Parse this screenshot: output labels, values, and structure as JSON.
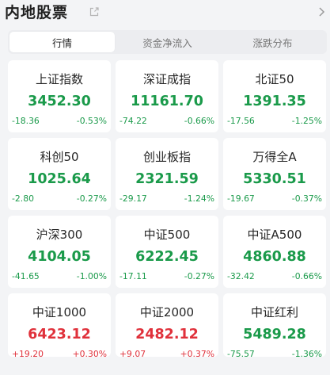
{
  "header": {
    "title": "内地股票",
    "share_icon": "share-external-icon",
    "more_icon": "chevron-right-icon"
  },
  "tabs": [
    {
      "label": "行情",
      "active": true
    },
    {
      "label": "资金净流入",
      "active": false
    },
    {
      "label": "涨跌分布",
      "active": false
    }
  ],
  "colors": {
    "down": "#1a9a4a",
    "up": "#e0313b"
  },
  "indices": [
    {
      "name": "上证指数",
      "value": "3452.30",
      "change": "-18.36",
      "percent": "-0.53%",
      "trend": "down"
    },
    {
      "name": "深证成指",
      "value": "11161.70",
      "change": "-74.22",
      "percent": "-0.66%",
      "trend": "down"
    },
    {
      "name": "北证50",
      "value": "1391.35",
      "change": "-17.56",
      "percent": "-1.25%",
      "trend": "down"
    },
    {
      "name": "科创50",
      "value": "1025.64",
      "change": "-2.80",
      "percent": "-0.27%",
      "trend": "down"
    },
    {
      "name": "创业板指",
      "value": "2321.59",
      "change": "-29.17",
      "percent": "-1.24%",
      "trend": "down"
    },
    {
      "name": "万得全A",
      "value": "5330.51",
      "change": "-19.67",
      "percent": "-0.37%",
      "trend": "down"
    },
    {
      "name": "沪深300",
      "value": "4104.05",
      "change": "-41.65",
      "percent": "-1.00%",
      "trend": "down"
    },
    {
      "name": "中证500",
      "value": "6222.45",
      "change": "-17.11",
      "percent": "-0.27%",
      "trend": "down"
    },
    {
      "name": "中证A500",
      "value": "4860.88",
      "change": "-32.42",
      "percent": "-0.66%",
      "trend": "down"
    },
    {
      "name": "中证1000",
      "value": "6423.12",
      "change": "+19.20",
      "percent": "+0.30%",
      "trend": "up"
    },
    {
      "name": "中证2000",
      "value": "2482.12",
      "change": "+9.07",
      "percent": "+0.37%",
      "trend": "up"
    },
    {
      "name": "中证红利",
      "value": "5489.28",
      "change": "-75.57",
      "percent": "-1.36%",
      "trend": "down"
    }
  ]
}
